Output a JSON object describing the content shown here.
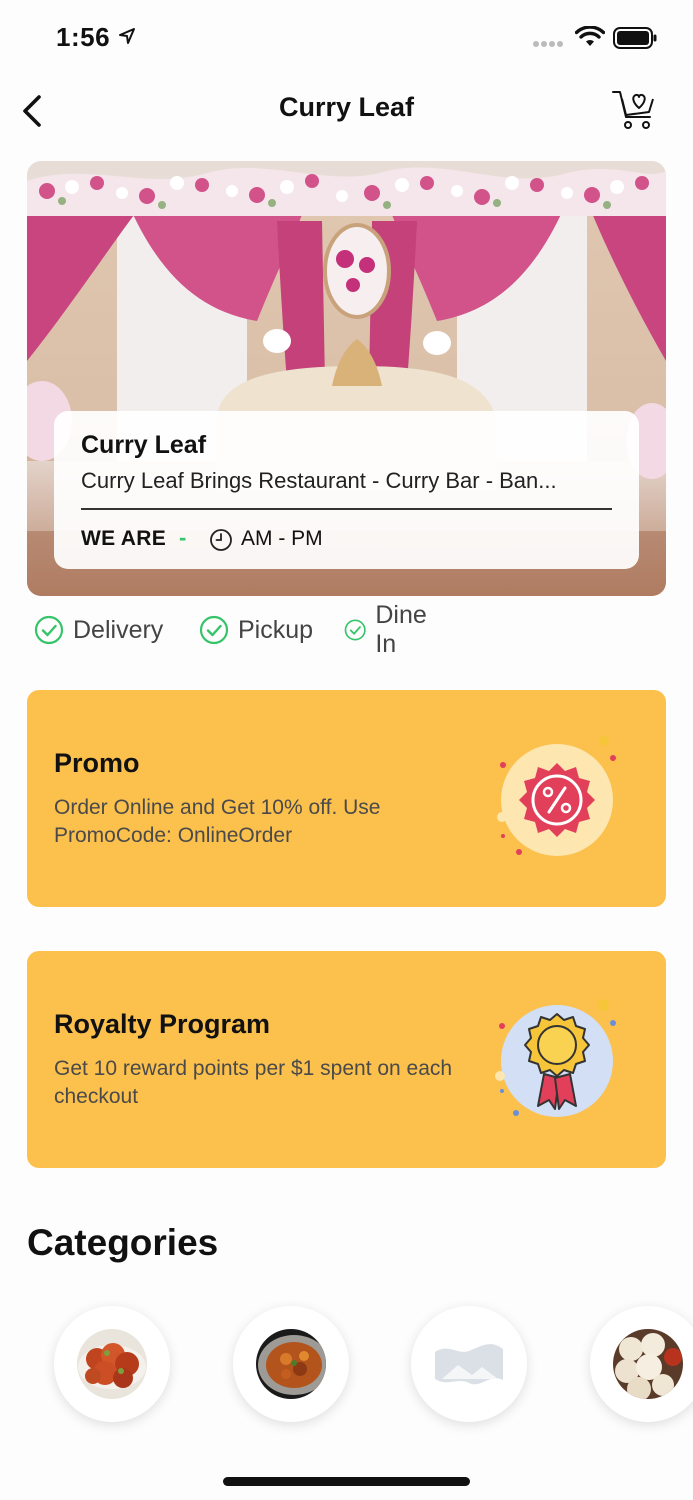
{
  "status_bar": {
    "time": "1:56"
  },
  "nav": {
    "title": "Curry Leaf"
  },
  "restaurant": {
    "name": "Curry Leaf",
    "description": "Curry Leaf Brings Restaurant - Curry Bar - Ban...",
    "status_label": "WE ARE",
    "status_value": "-",
    "hours": "AM - PM"
  },
  "services": [
    {
      "label": "Delivery"
    },
    {
      "label": "Pickup"
    },
    {
      "label": "Dine In"
    }
  ],
  "promo": {
    "title": "Promo",
    "text": "Order Online and Get 10% off. Use PromoCode: OnlineOrder",
    "icon": "discount-badge-icon"
  },
  "royalty": {
    "title": "Royalty Program",
    "text": "Get 10 reward points per $1 spent on each checkout",
    "icon": "award-medal-icon"
  },
  "categories": {
    "title": "Categories",
    "items": [
      {
        "icon": "chicken-dish-image"
      },
      {
        "icon": "curry-bowl-image"
      },
      {
        "icon": "placeholder-image-icon"
      },
      {
        "icon": "dumplings-image"
      }
    ]
  },
  "colors": {
    "card_bg": "#fcc04d",
    "check_green": "#36c46a",
    "status_green": "#36c46a"
  }
}
